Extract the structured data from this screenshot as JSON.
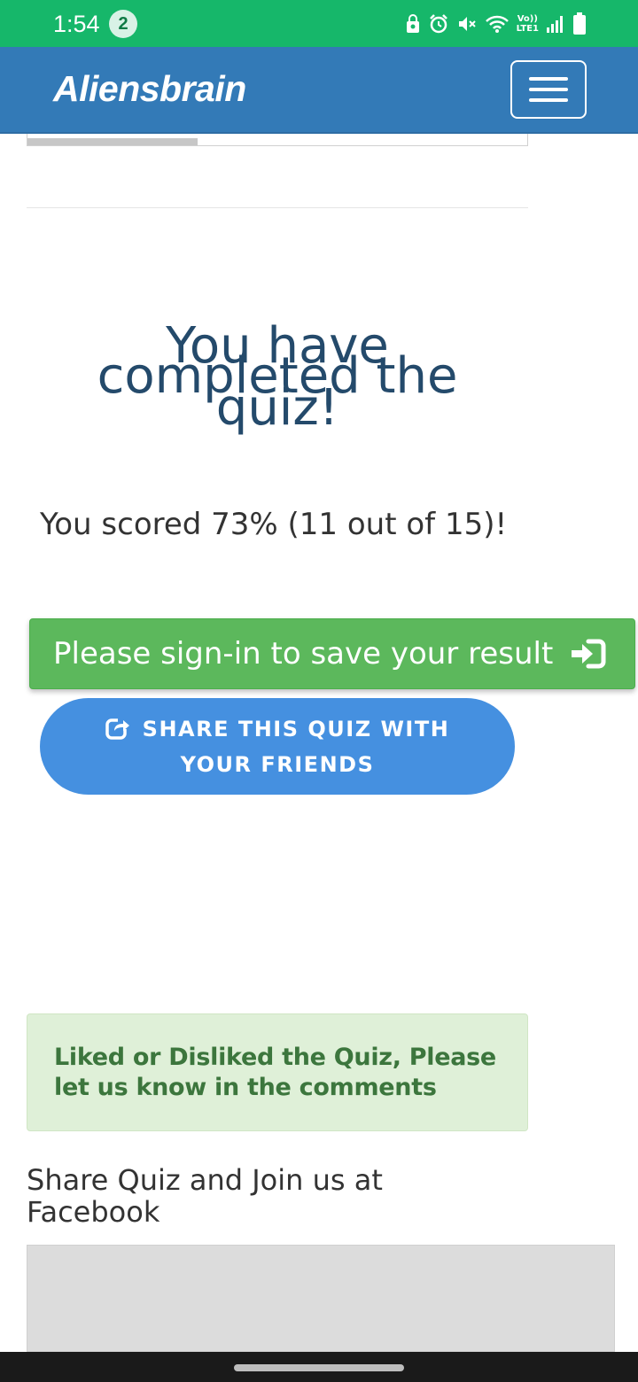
{
  "status_bar": {
    "time": "1:54",
    "notification_count": "2",
    "volte_label_top": "Vo))",
    "volte_label_bottom": "LTE1",
    "battery_level": "7"
  },
  "navbar": {
    "brand": "Aliensbrain"
  },
  "quiz_result": {
    "title_line1": "You have",
    "title_line2": "completed the",
    "title_line3": "quiz!",
    "score_text": "You scored 73% (11 out of 15)!"
  },
  "actions": {
    "signin_label": "Please sign-in to save your result",
    "share_label": "SHARE THIS QUIZ WITH YOUR FRIENDS"
  },
  "feedback": {
    "message": "Liked or Disliked the Quiz, Please let us know in the comments"
  },
  "facebook": {
    "heading": "Share Quiz and Join us at Facebook"
  },
  "colors": {
    "status_bar": "#16b76a",
    "navbar": "#337ab7",
    "signin_button": "#5cb85c",
    "share_button": "#4590e0",
    "feedback_bg": "#dff0d8",
    "feedback_text": "#3c763d",
    "title_text": "#244a6b"
  },
  "progress": {
    "fraction": 0.34
  }
}
